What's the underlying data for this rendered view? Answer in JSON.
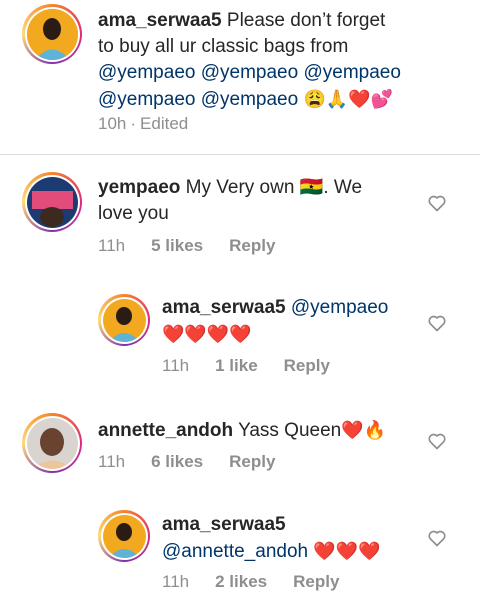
{
  "comments": [
    {
      "username": "ama_serwaa5",
      "text_1": "Please don’t forget",
      "text_2": "to buy all ur classic bags from",
      "mentions": [
        "@yempaeo",
        "@yempaeo",
        "@yempaeo",
        "@yempaeo",
        "@yempaeo"
      ],
      "emoji_tail": "😩🙏❤️💕",
      "time": "10h",
      "status": "Edited"
    },
    {
      "username": "yempaeo",
      "text_1": "My Very own 🇬🇭. We",
      "text_2": "love you",
      "time": "11h",
      "likes": "5 likes",
      "reply": "Reply"
    },
    {
      "username": "ama_serwaa5",
      "mention": "@yempaeo",
      "emoji": "❤️❤️❤️❤️",
      "time": "11h",
      "likes": "1 like",
      "reply": "Reply"
    },
    {
      "username": "annette_andoh",
      "text": "Yass Queen",
      "emoji": "❤️🔥",
      "time": "11h",
      "likes": "6 likes",
      "reply": "Reply"
    },
    {
      "username": "ama_serwaa5",
      "mention": "@annette_andoh",
      "emoji": "❤️❤️❤️",
      "time": "11h",
      "likes": "2 likes",
      "reply": "Reply"
    }
  ],
  "icons": {
    "like": "heart-outline-icon"
  }
}
